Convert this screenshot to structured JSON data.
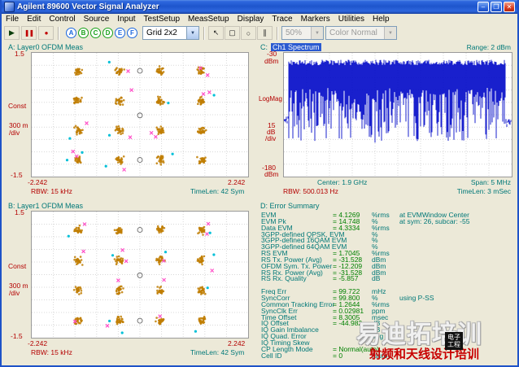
{
  "window": {
    "title": "Agilent 89600 Vector Signal Analyzer",
    "minimize": "–",
    "maximize": "❐",
    "close": "✕"
  },
  "menu": {
    "items": [
      "File",
      "Edit",
      "Control",
      "Source",
      "Input",
      "TestSetup",
      "MeasSetup",
      "Display",
      "Trace",
      "Markers",
      "Utilities",
      "Help"
    ]
  },
  "toolbar": {
    "play": "▶",
    "pause": "❚❚",
    "record": "●",
    "letter_buttons": [
      {
        "label": "A",
        "color": "#1A66DE"
      },
      {
        "label": "B",
        "color": "#18A018"
      },
      {
        "label": "C",
        "color": "#18A018"
      },
      {
        "label": "D",
        "color": "#18A018"
      },
      {
        "label": "E",
        "color": "#1A66DE"
      },
      {
        "label": "F",
        "color": "#1A66DE"
      }
    ],
    "grid_select": "Grid 2x2",
    "tools": [
      "↖",
      "▢",
      "○",
      "∥"
    ],
    "zoom_select": "50%",
    "color_select": "Color Normal"
  },
  "panelA": {
    "title": "A: Layer0 OFDM Meas",
    "y_max": "1.5",
    "y_min": "-1.5",
    "y_axis": "Const",
    "y_per_div": "300 m",
    "y_per_div2": "/div",
    "x_min": "-2.242",
    "x_max": "2.242",
    "rbw": "RBW: 15 kHz",
    "timelen": "TimeLen: 42 Sym"
  },
  "panelB": {
    "title": "B: Layer1 OFDM Meas",
    "y_max": "1.5",
    "y_min": "-1.5",
    "y_axis": "Const",
    "y_per_div": "300 m",
    "y_per_div2": "/div",
    "x_min": "-2.242",
    "x_max": "2.242",
    "rbw": "RBW: 15 kHz",
    "timelen": "TimeLen: 42 Sym"
  },
  "panelC": {
    "title_prefix": "C:",
    "title": "Ch1 Spectrum",
    "range": "Range: 2 dBm",
    "y_max": "-30",
    "y_max_unit": "dBm",
    "y_axis": "LogMag",
    "y_per_div": "15",
    "y_per_div_unit": "dB",
    "y_per_div2": "/div",
    "y_min": "-180",
    "y_min_unit": "dBm",
    "center": "Center: 1.9 GHz",
    "span": "Span: 5 MHz",
    "rbw": "RBW: 500.013 Hz",
    "timelen": "TimeLen: 3 mSec"
  },
  "panelD": {
    "title": "D: Error Summary",
    "rows": [
      {
        "l": "EVM",
        "v": "= 4.1269",
        "u": "%rms",
        "n": "at  EVMWindow Center"
      },
      {
        "l": "EVM Pk",
        "v": "= 14.748",
        "u": "%",
        "n": "at  sym: 26, subcar: -55"
      },
      {
        "l": "Data EVM",
        "v": "= 4.3334",
        "u": "%rms",
        "n": ""
      },
      {
        "l": "3GPP-defined QPSK, EVM",
        "v": "",
        "u": "%",
        "n": ""
      },
      {
        "l": "3GPP-defined 16QAM EVM",
        "v": "",
        "u": "%",
        "n": ""
      },
      {
        "l": "3GPP-defined 64QAM EVM",
        "v": "",
        "u": "%",
        "n": ""
      },
      {
        "l": "RS EVM",
        "v": "= 1.7045",
        "u": "%rms",
        "n": ""
      },
      {
        "l": "RS Tx. Power (Avg)",
        "v": "= -31.528",
        "u": "dBm",
        "n": ""
      },
      {
        "l": "OFDM Sym. Tx. Power",
        "v": "= -12.209",
        "u": "dBm",
        "n": ""
      },
      {
        "l": "RS Rx. Power (Avg)",
        "v": "= -31.528",
        "u": "dBm",
        "n": ""
      },
      {
        "l": "RS Rx. Quality",
        "v": "= -5.857",
        "u": "dB",
        "n": ""
      },
      {
        "l": "",
        "v": "",
        "u": "",
        "n": ""
      },
      {
        "l": "Freq Err",
        "v": "= 99.722",
        "u": "mHz",
        "n": ""
      },
      {
        "l": "SyncCorr",
        "v": "= 99.800",
        "u": "%",
        "n": "using  P-SS"
      },
      {
        "l": "Common Tracking Error",
        "v": "= 1.2644",
        "u": "%rms",
        "n": ""
      },
      {
        "l": "SyncClk Err",
        "v": "= 0.02981",
        "u": "ppm",
        "n": ""
      },
      {
        "l": "Time Offset",
        "v": "= 8.3005",
        "u": "msec",
        "n": ""
      },
      {
        "l": "IQ Offset",
        "v": "= -44.982",
        "u": "dB",
        "n": ""
      },
      {
        "l": "IQ Gain Imbalance",
        "v": "",
        "u": "dB",
        "n": ""
      },
      {
        "l": "IQ Quad. Error",
        "v": "",
        "u": "deg",
        "n": ""
      },
      {
        "l": "IQ Timing Skew",
        "v": "",
        "u": "",
        "n": ""
      },
      {
        "l": "CP Length Mode",
        "v": "= Normal(auto)",
        "u": "",
        "n": ""
      },
      {
        "l": "Cell ID",
        "v": "= 0",
        "u": "(auto)",
        "n": ""
      }
    ]
  },
  "colors": {
    "trace_blue": "#0008C8",
    "constellation_orange": "#C07C00",
    "error_pink": "#FF50C8",
    "pilot_cyan": "#00C0D8",
    "axis_red": "#B40000",
    "axis_teal": "#007878",
    "value_green": "#008000",
    "title_highlight": "#2A5AD0"
  },
  "watermark": {
    "title": "易迪拓培训",
    "subtitle": "射频和天线设计培训",
    "logo_line1": "电子",
    "logo_line2": "工程"
  }
}
